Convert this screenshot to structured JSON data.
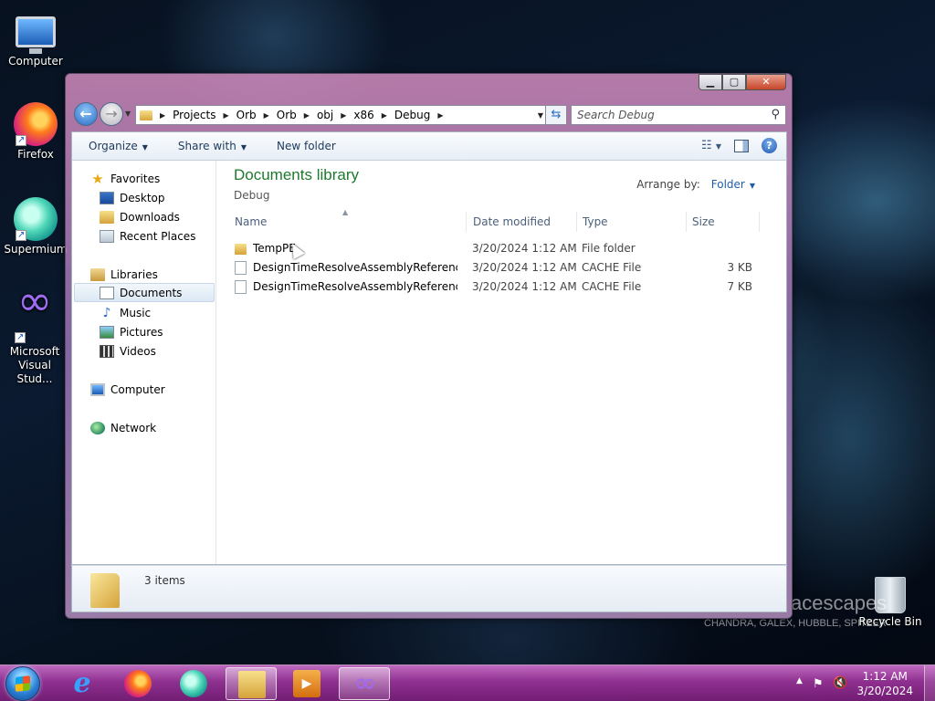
{
  "desktop": {
    "icons": [
      {
        "label": "Computer"
      },
      {
        "label": "Firefox"
      },
      {
        "label": "Supermium"
      },
      {
        "label": "Microsoft Visual Stud..."
      },
      {
        "label": "Recycle Bin"
      }
    ],
    "watermark": {
      "line1": "acescapes",
      "line2": "CHANDRA, GALEX, HUBBLE, SPITZER"
    }
  },
  "window": {
    "controls": {
      "minimize": "▁",
      "maximize": "▢",
      "close": "✕"
    },
    "breadcrumb": [
      "Projects",
      "Orb",
      "Orb",
      "obj",
      "x86",
      "Debug"
    ],
    "search_placeholder": "Search Debug",
    "toolbar": {
      "organize": "Organize",
      "share_with": "Share with",
      "new_folder": "New folder"
    },
    "nav_pane": {
      "favorites": "Favorites",
      "favorites_items": [
        "Desktop",
        "Downloads",
        "Recent Places"
      ],
      "libraries": "Libraries",
      "libraries_items": [
        "Documents",
        "Music",
        "Pictures",
        "Videos"
      ],
      "computer": "Computer",
      "network": "Network"
    },
    "library": {
      "title": "Documents library",
      "subtitle": "Debug",
      "arrange_label": "Arrange by:",
      "arrange_value": "Folder"
    },
    "columns": {
      "name": "Name",
      "date": "Date modified",
      "type": "Type",
      "size": "Size"
    },
    "files": [
      {
        "name": "TempPE",
        "date": "3/20/2024 1:12 AM",
        "type": "File folder",
        "size": "",
        "kind": "folder"
      },
      {
        "name": "DesignTimeResolveAssemblyReferences....",
        "date": "3/20/2024 1:12 AM",
        "type": "CACHE File",
        "size": "3 KB",
        "kind": "file"
      },
      {
        "name": "DesignTimeResolveAssemblyReferencesI...",
        "date": "3/20/2024 1:12 AM",
        "type": "CACHE File",
        "size": "7 KB",
        "kind": "file"
      }
    ],
    "details": {
      "count": "3 items"
    }
  },
  "taskbar": {
    "clock_time": "1:12 AM",
    "clock_date": "3/20/2024"
  }
}
